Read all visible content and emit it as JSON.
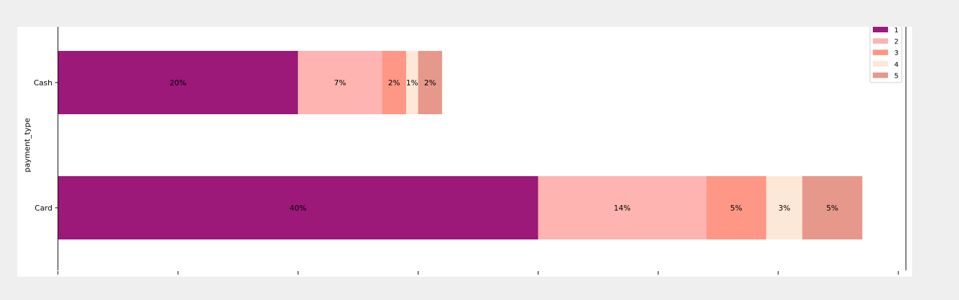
{
  "chart_data": {
    "type": "bar",
    "orientation": "horizontal",
    "stacked": true,
    "categories": [
      "Cash",
      "Card"
    ],
    "series": [
      {
        "name": "1",
        "color": "#9c1879",
        "values": [
          20,
          40
        ],
        "labels": [
          "20%",
          "40%"
        ]
      },
      {
        "name": "2",
        "color": "#feb4b1",
        "values": [
          7,
          14
        ],
        "labels": [
          "7%",
          "14%"
        ]
      },
      {
        "name": "3",
        "color": "#fe9785",
        "values": [
          2,
          5
        ],
        "labels": [
          "2%",
          "5%"
        ]
      },
      {
        "name": "4",
        "color": "#fde7d7",
        "values": [
          1,
          3
        ],
        "labels": [
          "1%",
          "3%"
        ]
      },
      {
        "name": "5",
        "color": "#e6988a",
        "values": [
          2,
          5
        ],
        "labels": [
          "2%",
          "5%"
        ]
      }
    ],
    "ylabel": "payment_type",
    "xlabel": "",
    "xlim": [
      0,
      70
    ],
    "x_ticks": [
      0,
      10,
      20,
      30,
      40,
      50,
      60,
      70
    ],
    "x_tick_labels_visible": false,
    "grid": false,
    "legend": {
      "placement": "top-right"
    }
  }
}
